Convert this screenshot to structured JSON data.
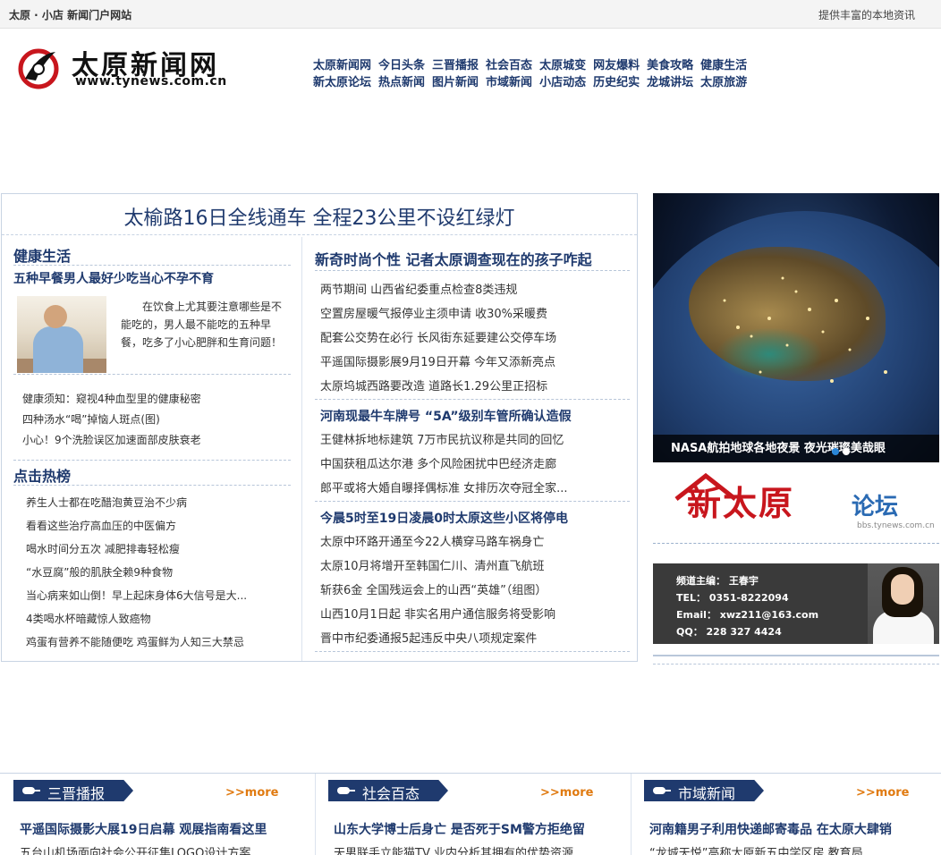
{
  "topbar": {
    "site_label": "太原 · 小店  新闻门户网站",
    "tagline": "提供丰富的本地资讯"
  },
  "logo": {
    "name": "太原新闻网",
    "url": "www.tynews.com.cn"
  },
  "nav": {
    "row1": [
      "太原新闻网",
      "今日头条",
      "三晋播报",
      "社会百态",
      "太原城变",
      "网友爆料",
      "美食攻略",
      "健康生活"
    ],
    "row2": [
      "新太原论坛",
      "热点新闻",
      "图片新闻",
      "市域新闻",
      "小店动态",
      "历史纪实",
      "龙城讲坛",
      "太原旅游"
    ]
  },
  "headline": "太榆路16日全线通车  全程23公里不设红绿灯",
  "health": {
    "title": "健康生活",
    "feature_title": "五种早餐男人最好少吃当心不孕不育",
    "feature_desc": "在饮食上尤其要注意哪些是不能吃的，男人最不能吃的五种早餐，吃多了小心肥胖和生育问题！",
    "items": [
      "健康须知：窥视4种血型里的健康秘密",
      "四种汤水“喝”掉恼人斑点(图)",
      "小心！9个洗脸误区加速面部皮肤衰老"
    ]
  },
  "hot": {
    "title": "点击热榜",
    "items": [
      "养生人士都在吃醋泡黄豆治不少病",
      "看看这些治疗高血压的中医偏方",
      "喝水时间分五次  减肥排毒轻松瘦",
      "“水豆腐”般的肌肤全赖9种食物",
      "当心病来如山倒！早上起床身体6大信号是大...",
      "4类喝水杯暗藏惊人致癌物",
      "鸡蛋有营养不能随便吃  鸡蛋鲜为人知三大禁忌"
    ]
  },
  "news": {
    "top_title": "新奇时尚个性  记者太原调查现在的孩子咋起",
    "group1": [
      "两节期间  山西省纪委重点检查8类违规",
      "空置房屋暖气报停业主须申请  收30%采暖费",
      "配套公交势在必行  长风街东延要建公交停车场",
      "平遥国际摄影展9月19日开幕  今年又添新亮点",
      "太原坞城西路要改造  道路长1.29公里正招标"
    ],
    "group2_title": "河南现最牛车牌号  “5A”级别车管所确认造假",
    "group2": [
      "王健林拆地标建筑  7万市民抗议称是共同的回忆",
      "中国获租瓜达尔港  多个风险困扰中巴经济走廊",
      "郎平或将大婚自曝择偶标准  女排历次夺冠全家..."
    ],
    "group3_title": "今晨5时至19日凌晨0时太原这些小区将停电",
    "group3": [
      "太原中环路开通至今22人横穿马路车祸身亡",
      "太原10月将增开至韩国仁川、清州直飞航班",
      "斩获6金  全国残运会上的山西“英雄”（组图）",
      "山西10月1日起  非实名用户通信服务将受影响",
      "晋中市纪委通报5起违反中央八项规定案件"
    ]
  },
  "slideshow": {
    "caption": "NASA航拍地球各地夜景  夜光璀璨美哉眼"
  },
  "forum": {
    "name": "新太原",
    "suffix": "论坛",
    "domain": "bbs.tynews.com.cn"
  },
  "editor": {
    "lines": [
      "频道主编：  王春宇",
      "TEL：  0351-8222094",
      "Email：  xwz211@163.com",
      "QQ：  228 327 4424"
    ]
  },
  "bottom": [
    {
      "tab": "三晋播报",
      "more": ">>more",
      "title": "平遥国际摄影大展19日启幕  观展指南看这里",
      "sub": "五台山机场面向社会公开征集LOGO设计方案"
    },
    {
      "tab": "社会百态",
      "more": ">>more",
      "title": "山东大学博士后身亡  是否死于SM警方拒绝留",
      "sub": "天男联手立能猫TV  业内分析其拥有的优势资源"
    },
    {
      "tab": "市域新闻",
      "more": ">>more",
      "title": "河南籍男子利用快递邮寄毒品  在太原大肆销",
      "sub": "“龙城天悦”高称太原新五中学区房  教育局"
    }
  ],
  "colors": {
    "navy": "#1f3a6e",
    "accent_red": "#c8161d",
    "more_orange": "#e07a10",
    "border": "#c8d4e3"
  }
}
